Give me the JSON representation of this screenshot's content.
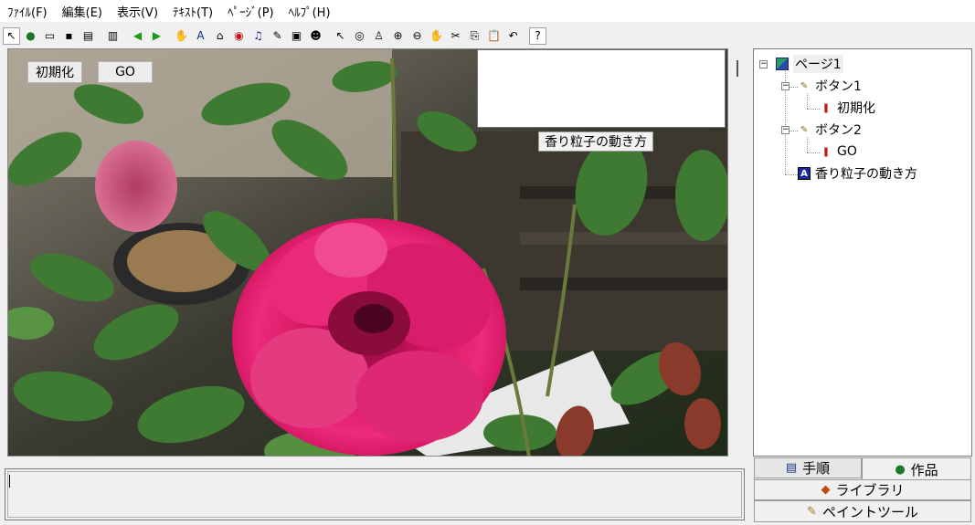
{
  "menu": [
    "ﾌｧｲﾙ(F)",
    "編集(E)",
    "表示(V)",
    "ﾃｷｽﾄ(T)",
    "ﾍﾟｰｼﾞ(P)",
    "ﾍﾙﾌﾟ(H)"
  ],
  "toolbar": {
    "icons": [
      "pointer-small-icon",
      "globe-icon",
      "open-folder-icon",
      "save-icon",
      "print-icon",
      "sep",
      "grid-icon",
      "sep",
      "arrow-left-icon",
      "arrow-right-icon",
      "sep",
      "hand-icon",
      "text-a-icon",
      "button-tool-icon",
      "eye-icon",
      "music-icon",
      "pen-icon",
      "movie-icon",
      "sprite-icon",
      "sep",
      "cursor-icon",
      "view-eye-icon",
      "stamp-icon",
      "zoom-in-icon",
      "zoom-out-icon",
      "stop-hand-icon",
      "cut-icon",
      "copy-icon",
      "paste-icon",
      "undo-icon",
      "sep",
      "help-icon"
    ],
    "glyphs": {
      "pointer-small-icon": "↖",
      "globe-icon": "●",
      "open-folder-icon": "▭",
      "save-icon": "▪",
      "print-icon": "▤",
      "grid-icon": "▥",
      "arrow-left-icon": "◀",
      "arrow-right-icon": "▶",
      "hand-icon": "✋",
      "text-a-icon": "A",
      "button-tool-icon": "⌂",
      "eye-icon": "◉",
      "music-icon": "♫",
      "pen-icon": "✎",
      "movie-icon": "▣",
      "sprite-icon": "☻",
      "cursor-icon": "↖",
      "view-eye-icon": "◎",
      "stamp-icon": "♙",
      "zoom-in-icon": "⊕",
      "zoom-out-icon": "⊖",
      "stop-hand-icon": "✋",
      "cut-icon": "✂",
      "copy-icon": "⎘",
      "paste-icon": "📋",
      "undo-icon": "↶",
      "help-icon": "?"
    },
    "colors": {
      "globe-icon": "#1a7a2a",
      "arrow-left-icon": "#1a9a1a",
      "arrow-right-icon": "#1a9a1a",
      "text-a-icon": "#0a2a8a",
      "eye-icon": "#c01010",
      "stop-hand-icon": "#d01010",
      "music-icon": "#2020a0"
    }
  },
  "stage": {
    "reset_button": "初期化",
    "go_button": "GO",
    "caption": "香り粒子の動き方"
  },
  "tree": {
    "page": "ページ1",
    "button1": "ボタン1",
    "button1_child": "初期化",
    "button2": "ボタン2",
    "button2_child": "GO",
    "text_item": "香り粒子の動き方"
  },
  "tabs": {
    "procedure": "手順",
    "work": "作品",
    "library": "ライブラリ",
    "paint_tool": "ペイントツール"
  }
}
